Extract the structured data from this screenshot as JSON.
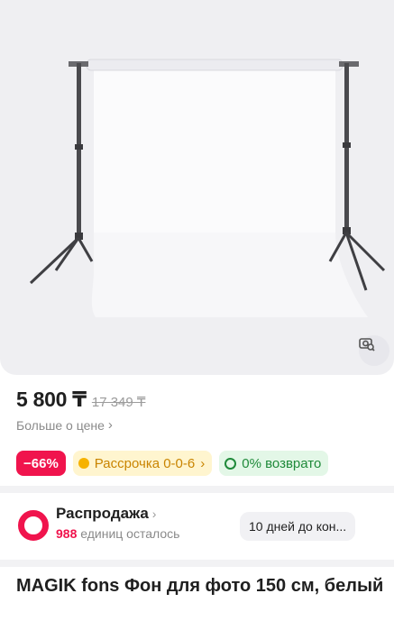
{
  "price": {
    "current": "5 800 ₸",
    "old": "17 349 ₸",
    "more_label": "Больше о цене",
    "more_chevron": "›"
  },
  "badges": {
    "discount": "−66%",
    "installment": "Рассрочка 0-0-6",
    "installment_chevron": "›",
    "return_label": "0% возврато"
  },
  "sale": {
    "title": "Распродажа",
    "chevron": "›",
    "count": "988",
    "remaining_label": "единиц осталось",
    "timer": "10 дней до кон..."
  },
  "product": {
    "title": "MAGIK fons Фон для фото 150 см, белый"
  },
  "colors": {
    "accent_pink": "#f0144d",
    "installment_bg": "#fff5cf",
    "installment_text": "#c98400",
    "return_bg": "#e3f7e7",
    "return_text": "#1f8a3a"
  },
  "icons": {
    "visual_search": "camera-search-icon",
    "sale": "sale-ring-icon"
  }
}
